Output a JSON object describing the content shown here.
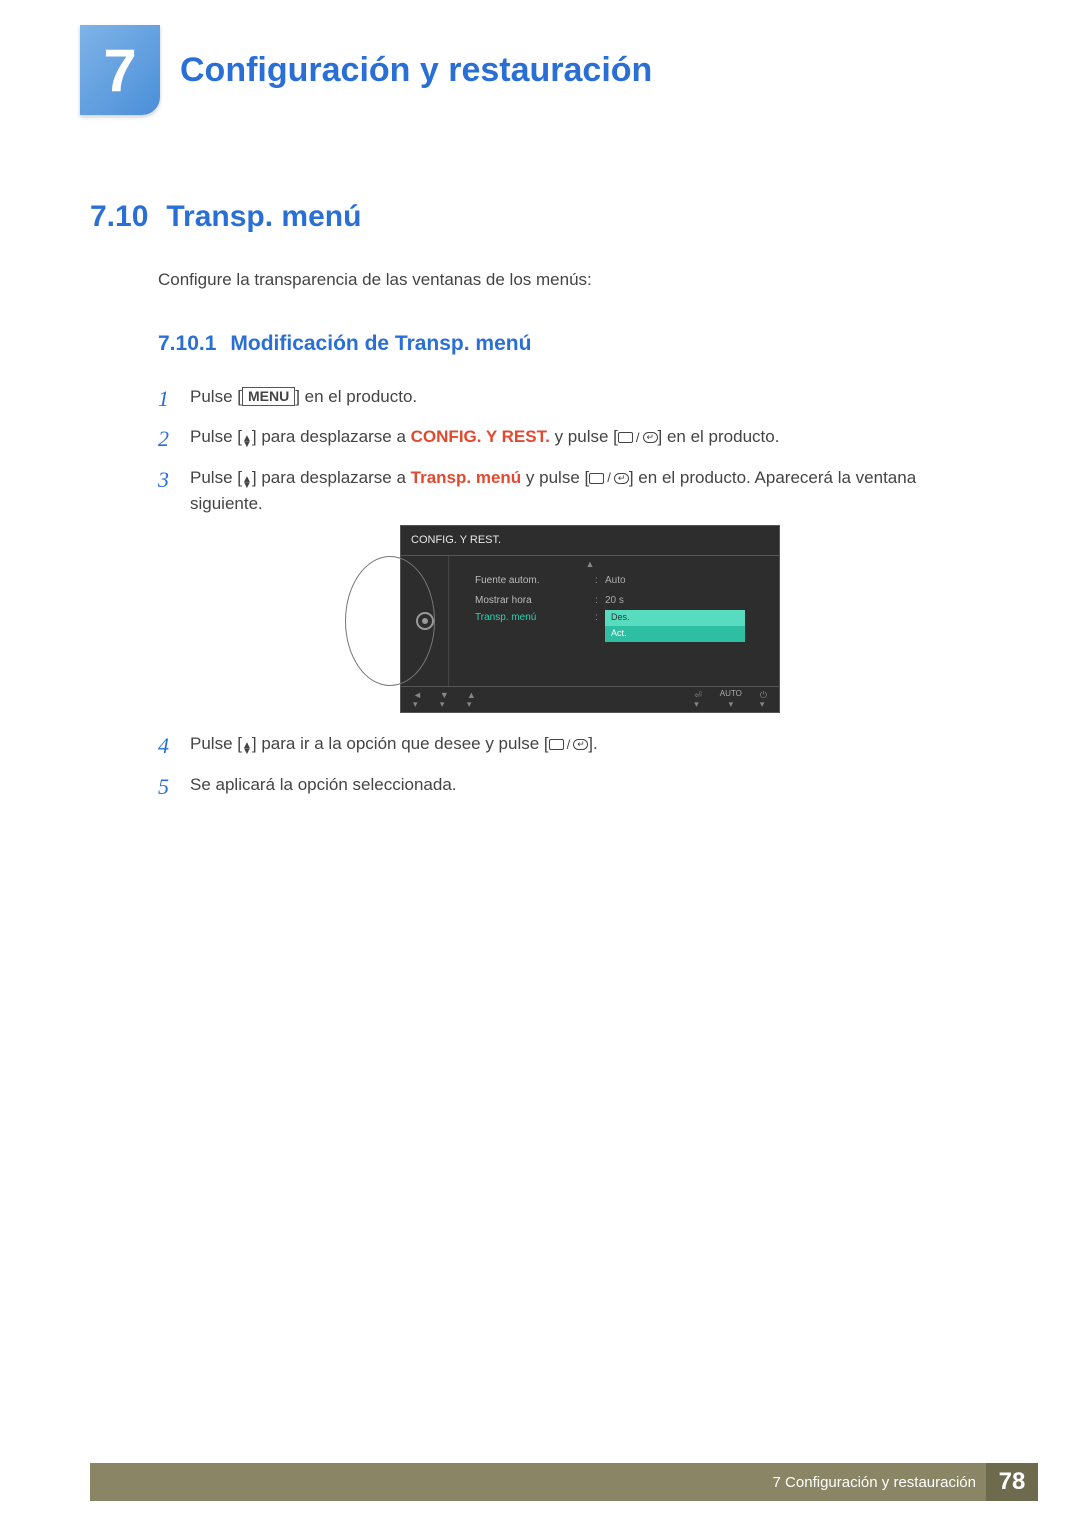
{
  "chapter": {
    "number": "7",
    "title": "Configuración y restauración"
  },
  "section": {
    "number": "7.10",
    "title": "Transp. menú"
  },
  "intro": "Configure la transparencia de las ventanas de los menús:",
  "subsection": {
    "number": "7.10.1",
    "title": "Modificación de Transp. menú"
  },
  "steps": {
    "s1": {
      "num": "1",
      "a": "Pulse [",
      "menu": "MENU",
      "b": "] en el producto."
    },
    "s2": {
      "num": "2",
      "a": "Pulse [",
      "b": "] para desplazarse a ",
      "target": "CONFIG. Y REST.",
      "c": " y pulse [",
      "d": "] en el producto."
    },
    "s3": {
      "num": "3",
      "a": "Pulse [",
      "b": "] para desplazarse a ",
      "target": "Transp. menú",
      "c": " y pulse [",
      "d": "] en el producto. Aparecerá la ventana siguiente."
    },
    "s4": {
      "num": "4",
      "a": "Pulse [",
      "b": "] para ir a la opción que desee y pulse [",
      "c": "]."
    },
    "s5": {
      "num": "5",
      "text": "Se aplicará la opción seleccionada."
    }
  },
  "osd": {
    "title": "CONFIG. Y REST.",
    "rows": [
      {
        "label": "Fuente autom.",
        "value": "Auto",
        "active": false
      },
      {
        "label": "Mostrar hora",
        "value": "20 s",
        "active": false
      },
      {
        "label": "Transp. menú",
        "value": "",
        "active": true
      }
    ],
    "dropdown": {
      "opt1": "Des.",
      "opt2": "Act."
    },
    "footer_auto": "AUTO"
  },
  "footer": {
    "text": "7 Configuración y restauración",
    "page": "78"
  }
}
